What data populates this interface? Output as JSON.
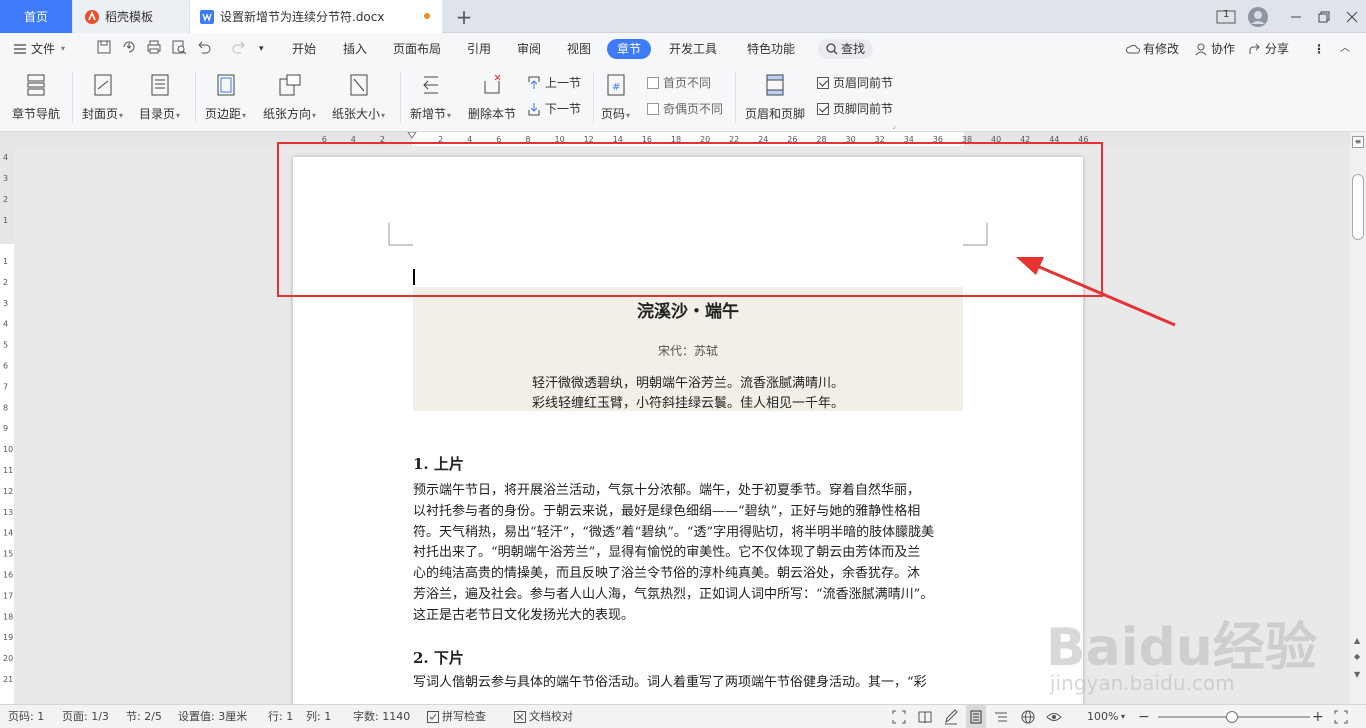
{
  "tabs": {
    "home": "首页",
    "daoke": "稻壳模板",
    "doc": "设置新增节为连续分节符.docx",
    "badge": "1"
  },
  "menu": {
    "file": "文件",
    "items": [
      "开始",
      "插入",
      "页面布局",
      "引用",
      "审阅",
      "视图",
      "章节",
      "开发工具",
      "特色功能"
    ],
    "search": "查找",
    "changes": "有修改",
    "collab": "协作",
    "share": "分享"
  },
  "ribbon": {
    "nav": "章节导航",
    "cover": "封面页",
    "toc": "目录页",
    "margin": "页边距",
    "orient": "纸张方向",
    "size": "纸张大小",
    "new_section": "新增节",
    "delete_section": "删除本节",
    "prev_section": "上一节",
    "next_section": "下一节",
    "pagenum": "页码",
    "first_diff": "首页不同",
    "oddeven_diff": "奇偶页不同",
    "header_footer": "页眉和页脚",
    "header_same": "页眉同前节",
    "footer_same": "页脚同前节"
  },
  "ruler": {
    "h_ticks": [
      "6",
      "4",
      "2",
      "2",
      "4",
      "6",
      "8",
      "10",
      "12",
      "14",
      "16",
      "18",
      "20",
      "22",
      "24",
      "26",
      "28",
      "30",
      "32",
      "34",
      "36",
      "38",
      "40",
      "42",
      "44",
      "46"
    ],
    "v_ticks": [
      "4",
      "3",
      "2",
      "1",
      "1",
      "2",
      "3",
      "4",
      "5",
      "6",
      "7",
      "8",
      "9",
      "10",
      "11",
      "12",
      "13",
      "14",
      "15",
      "16",
      "17",
      "18",
      "19",
      "20",
      "21"
    ]
  },
  "document": {
    "poem_title": "浣溪沙・端午",
    "poem_author": "宋代：苏轼",
    "poem_lines": [
      "轻汗微微透碧纨，明朝端午浴芳兰。流香涨腻满晴川。",
      "彩线轻缠红玉臂，小符斜挂绿云鬟。佳人相见一千年。"
    ],
    "section1_title": "1.  上片",
    "section1_lines": [
      "预示端午节日，将开展浴兰活动，气氛十分浓郁。端午，处于初夏季节。穿着自然华丽，",
      "以衬托参与者的身份。于朝云来说，最好是绿色细绢——“碧纨”，正好与她的雅静性格相",
      "符。天气稍热，易出“轻汗”，“微透”着“碧纨”。“透”字用得贴切，将半明半暗的肢体朦胧美",
      "衬托出来了。“明朝端午浴芳兰”，显得有愉悦的审美性。它不仅体现了朝云由芳体而及兰",
      "心的纯洁高贵的情操美，而且反映了浴兰令节俗的淳朴纯真美。朝云浴处，余香犹存。沐",
      "芳浴兰，遍及社会。参与者人山人海，气氛热烈，正如词人词中所写：“流香涨腻满晴川”。",
      "这正是古老节日文化发扬光大的表现。"
    ],
    "section2_title": "2.  下片",
    "section2_lines": [
      "写词人偕朝云参与具体的端午节俗活动。词人着重写了两项端午节俗健身活动。其一，“彩"
    ]
  },
  "status": {
    "page": "页码: 1",
    "pages": "页面: 1/3",
    "section": "节: 2/5",
    "setting": "设置值: 3厘米",
    "row": "行: 1",
    "col": "列: 1",
    "words": "字数: 1140",
    "spell": "拼写检查",
    "proof": "文档校对",
    "zoom": "100%"
  },
  "watermark": {
    "brand": "Baidu经验",
    "url": "jingyan.baidu.com"
  },
  "colors": {
    "accent": "#3e7bfa",
    "annotation": "#e53333",
    "poem_bg": "#f1efe6"
  }
}
